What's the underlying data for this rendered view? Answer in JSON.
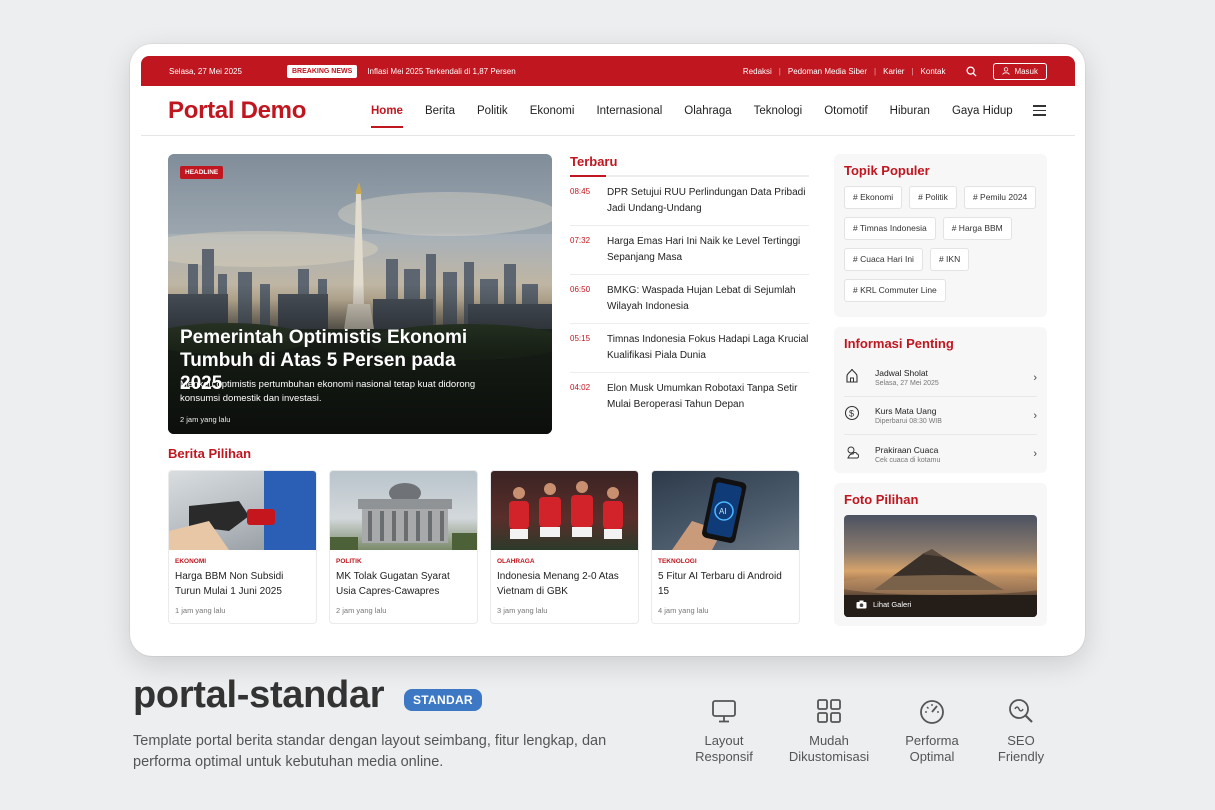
{
  "topbar": {
    "date": "Selasa, 27 Mei 2025",
    "breaking_label": "BREAKING NEWS",
    "breaking_text": "Inflasi Mei 2025 Terkendali di 1,87 Persen",
    "links": [
      "Redaksi",
      "Pedoman Media Siber",
      "Karier",
      "Kontak"
    ],
    "login": "Masuk"
  },
  "nav": {
    "logo": "Portal Demo",
    "items": [
      "Home",
      "Berita",
      "Politik",
      "Ekonomi",
      "Internasional",
      "Olahraga",
      "Teknologi",
      "Otomotif",
      "Hiburan",
      "Gaya Hidup"
    ]
  },
  "headline": {
    "tag": "HEADLINE",
    "title": "Pemerintah Optimistis Ekonomi Tumbuh di Atas 5 Persen pada 2025",
    "summary": "Menkeu optimistis pertumbuhan ekonomi nasional tetap kuat didorong konsumsi domestik dan investasi.",
    "time": "2 jam yang lalu"
  },
  "terbaru": {
    "heading": "Terbaru",
    "items": [
      {
        "time": "08:45",
        "title": "DPR Setujui RUU Perlindungan Data Pribadi Jadi Undang-Undang"
      },
      {
        "time": "07:32",
        "title": "Harga Emas Hari Ini Naik ke Level Tertinggi Sepanjang Masa"
      },
      {
        "time": "06:50",
        "title": "BMKG: Waspada Hujan Lebat di Sejumlah Wilayah Indonesia"
      },
      {
        "time": "05:15",
        "title": "Timnas Indonesia Fokus Hadapi Laga Krucial Kualifikasi Piala Dunia"
      },
      {
        "time": "04:02",
        "title": "Elon Musk Umumkan Robotaxi Tanpa Setir Mulai Beroperasi Tahun Depan"
      }
    ]
  },
  "berita_pilihan": {
    "heading": "Berita Pilihan",
    "cards": [
      {
        "category": "EKONOMI",
        "title": "Harga BBM Non Subsidi Turun Mulai 1 Juni 2025",
        "time": "1 jam yang lalu"
      },
      {
        "category": "POLITIK",
        "title": "MK Tolak Gugatan Syarat Usia Capres-Cawapres",
        "time": "2 jam yang lalu"
      },
      {
        "category": "OLAHRAGA",
        "title": "Indonesia Menang 2-0 Atas Vietnam di GBK",
        "time": "3 jam yang lalu"
      },
      {
        "category": "TEKNOLOGI",
        "title": "5 Fitur AI Terbaru di Android 15",
        "time": "4 jam yang lalu"
      }
    ]
  },
  "topik": {
    "heading": "Topik Populer",
    "chips": [
      "# Ekonomi",
      "# Politik",
      "# Pemilu 2024",
      "# Timnas Indonesia",
      "# Harga BBM",
      "# Cuaca Hari Ini",
      "# IKN",
      "# KRL Commuter Line"
    ]
  },
  "informasi": {
    "heading": "Informasi Penting",
    "items": [
      {
        "icon": "mosque-icon",
        "title": "Jadwal Sholat",
        "sub": "Selasa, 27 Mei 2025"
      },
      {
        "icon": "dollar-icon",
        "title": "Kurs Mata Uang",
        "sub": "Diperbarui 08:30 WIB"
      },
      {
        "icon": "cloud-sun-icon",
        "title": "Prakiraan Cuaca",
        "sub": "Cek cuaca di kotamu"
      }
    ]
  },
  "foto": {
    "heading": "Foto Pilihan",
    "label": "Lihat Galeri"
  },
  "caption": {
    "title": "portal-standar",
    "badge": "STANDAR",
    "description": "Template portal berita standar dengan layout seimbang, fitur lengkap, dan performa optimal untuk kebutuhan media online.",
    "features": [
      {
        "icon": "monitor-icon",
        "line1": "Layout",
        "line2": "Responsif"
      },
      {
        "icon": "grid-icon",
        "line1": "Mudah",
        "line2": "Dikustomisasi"
      },
      {
        "icon": "gauge-icon",
        "line1": "Performa",
        "line2": "Optimal"
      },
      {
        "icon": "seo-search-icon",
        "line1": "SEO",
        "line2": "Friendly"
      }
    ]
  },
  "colors": {
    "accent": "#c0161f",
    "badge": "#3d78c5",
    "background": "#eceef0"
  }
}
